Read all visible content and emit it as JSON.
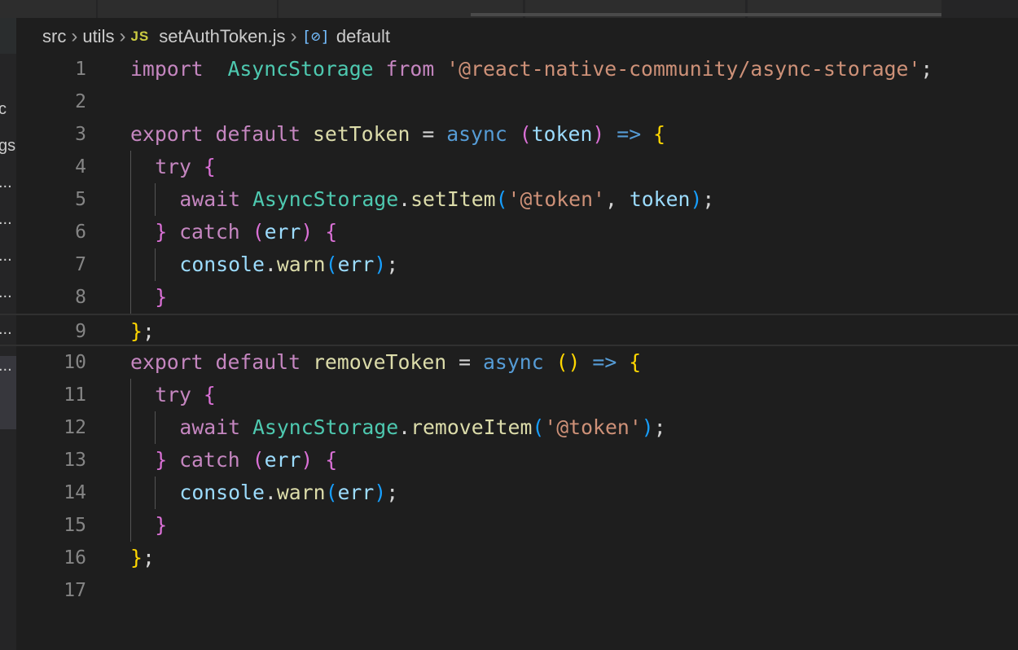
{
  "breadcrumb": {
    "items": [
      "src",
      "utils"
    ],
    "file_icon": "JS",
    "file": "setAuthToken.js",
    "symbol_icon": "[⊘]",
    "symbol": "default",
    "separator": "›"
  },
  "sidebar_fragments": [
    "c",
    "gs",
    "...",
    "...",
    "...",
    "...",
    "...",
    "..."
  ],
  "line_numbers": [
    "1",
    "2",
    "3",
    "4",
    "5",
    "6",
    "7",
    "8",
    "9",
    "10",
    "11",
    "12",
    "13",
    "14",
    "15",
    "16",
    "17"
  ],
  "current_line": "9",
  "colors": {
    "background": "#1e1e1e",
    "keyword": "#c586c0",
    "storage": "#569cd6",
    "type": "#4ec9b0",
    "variable": "#9cdcfe",
    "function": "#dcdcaa",
    "string": "#ce9178",
    "bracket_1": "#ffd700",
    "bracket_2": "#da70d6",
    "bracket_3": "#179fff"
  },
  "code_lines": [
    [
      [
        "kw",
        "import"
      ],
      [
        "",
        "  "
      ],
      [
        "ty",
        "AsyncStorage"
      ],
      [
        "",
        " "
      ],
      [
        "kw",
        "from"
      ],
      [
        "",
        " "
      ],
      [
        "sr",
        "'@react-native-community/async-storage'"
      ],
      [
        "",
        ";"
      ]
    ],
    [],
    [
      [
        "kw",
        "export"
      ],
      [
        "",
        " "
      ],
      [
        "kw",
        "default"
      ],
      [
        "",
        " "
      ],
      [
        "fn",
        "setToken"
      ],
      [
        "",
        " = "
      ],
      [
        "st",
        "async"
      ],
      [
        "",
        " "
      ],
      [
        "b2",
        "("
      ],
      [
        "vr",
        "token"
      ],
      [
        "b2",
        ")"
      ],
      [
        "",
        " "
      ],
      [
        "st",
        "=>"
      ],
      [
        "",
        " "
      ],
      [
        "b1",
        "{"
      ]
    ],
    [
      [
        "",
        ""
      ],
      [
        "kw",
        "try"
      ],
      [
        "",
        " "
      ],
      [
        "b2",
        "{"
      ]
    ],
    [
      [
        "",
        ""
      ],
      [
        "kw",
        "await"
      ],
      [
        "",
        " "
      ],
      [
        "ty",
        "AsyncStorage"
      ],
      [
        "",
        "."
      ],
      [
        "fn",
        "setItem"
      ],
      [
        "b3",
        "("
      ],
      [
        "sr",
        "'@token'"
      ],
      [
        "",
        ", "
      ],
      [
        "vr",
        "token"
      ],
      [
        "b3",
        ")"
      ],
      [
        "",
        ";"
      ]
    ],
    [
      [
        "",
        ""
      ],
      [
        "b2",
        "}"
      ],
      [
        "",
        " "
      ],
      [
        "kw",
        "catch"
      ],
      [
        "",
        " "
      ],
      [
        "b2",
        "("
      ],
      [
        "vr",
        "err"
      ],
      [
        "b2",
        ")"
      ],
      [
        "",
        " "
      ],
      [
        "b2",
        "{"
      ]
    ],
    [
      [
        "",
        ""
      ],
      [
        "vr",
        "console"
      ],
      [
        "",
        "."
      ],
      [
        "fn",
        "warn"
      ],
      [
        "b3",
        "("
      ],
      [
        "vr",
        "err"
      ],
      [
        "b3",
        ")"
      ],
      [
        "",
        ";"
      ]
    ],
    [
      [
        "",
        ""
      ],
      [
        "b2",
        "}"
      ]
    ],
    [
      [
        "b1",
        "}"
      ],
      [
        "",
        ";"
      ]
    ],
    [
      [
        "kw",
        "export"
      ],
      [
        "",
        " "
      ],
      [
        "kw",
        "default"
      ],
      [
        "",
        " "
      ],
      [
        "fn",
        "removeToken"
      ],
      [
        "",
        " = "
      ],
      [
        "st",
        "async"
      ],
      [
        "",
        " "
      ],
      [
        "b1",
        "()"
      ],
      [
        "",
        " "
      ],
      [
        "st",
        "=>"
      ],
      [
        "",
        " "
      ],
      [
        "b1",
        "{"
      ]
    ],
    [
      [
        "",
        ""
      ],
      [
        "kw",
        "try"
      ],
      [
        "",
        " "
      ],
      [
        "b2",
        "{"
      ]
    ],
    [
      [
        "",
        ""
      ],
      [
        "kw",
        "await"
      ],
      [
        "",
        " "
      ],
      [
        "ty",
        "AsyncStorage"
      ],
      [
        "",
        "."
      ],
      [
        "fn",
        "removeItem"
      ],
      [
        "b3",
        "("
      ],
      [
        "sr",
        "'@token'"
      ],
      [
        "b3",
        ")"
      ],
      [
        "",
        ";"
      ]
    ],
    [
      [
        "",
        ""
      ],
      [
        "b2",
        "}"
      ],
      [
        "",
        " "
      ],
      [
        "kw",
        "catch"
      ],
      [
        "",
        " "
      ],
      [
        "b2",
        "("
      ],
      [
        "vr",
        "err"
      ],
      [
        "b2",
        ")"
      ],
      [
        "",
        " "
      ],
      [
        "b2",
        "{"
      ]
    ],
    [
      [
        "",
        ""
      ],
      [
        "vr",
        "console"
      ],
      [
        "",
        "."
      ],
      [
        "fn",
        "warn"
      ],
      [
        "b3",
        "("
      ],
      [
        "vr",
        "err"
      ],
      [
        "b3",
        ")"
      ],
      [
        "",
        ";"
      ]
    ],
    [
      [
        "",
        ""
      ],
      [
        "b2",
        "}"
      ]
    ],
    [
      [
        "b1",
        "}"
      ],
      [
        "",
        ";"
      ]
    ],
    []
  ]
}
